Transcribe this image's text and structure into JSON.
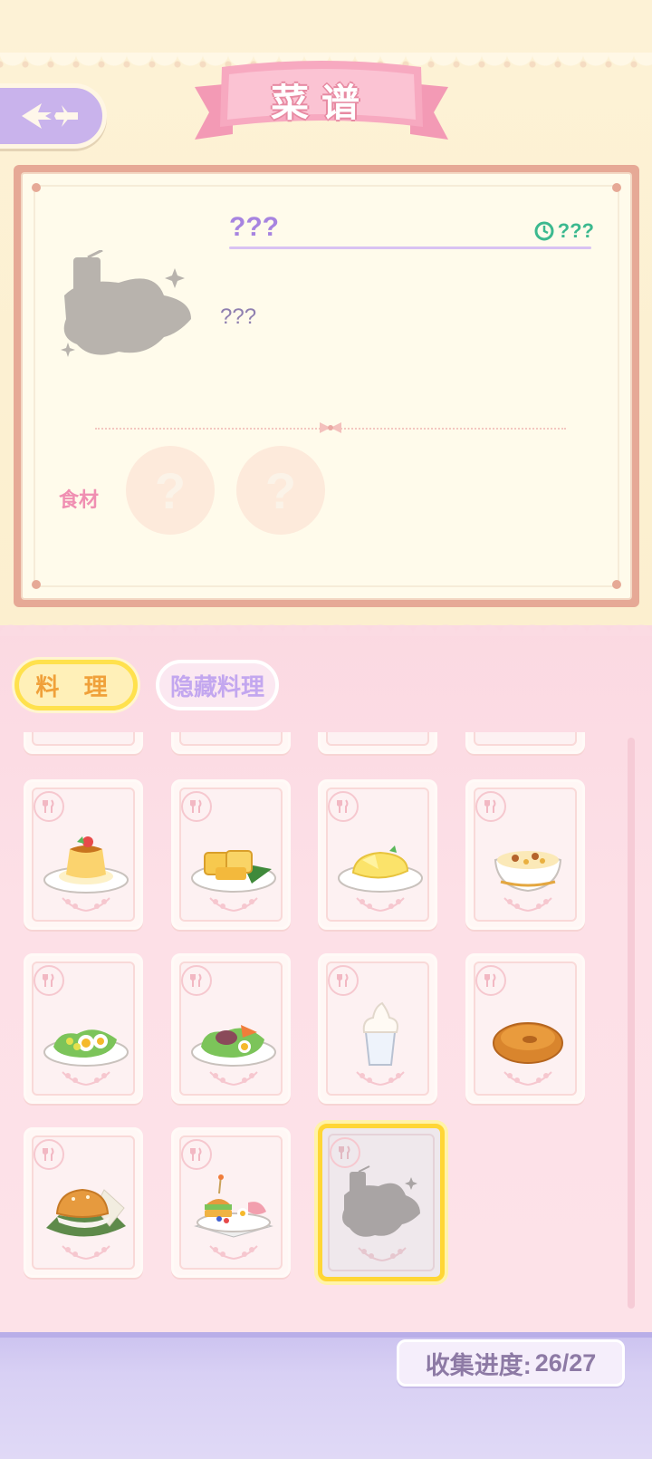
{
  "header": {
    "title": "菜谱",
    "back_icon": "back-arrow-icon"
  },
  "detail": {
    "dish_name": "???",
    "cook_time": "???",
    "description": "???",
    "ingredients_label": "食材",
    "ingredient_slots": [
      "?",
      "?"
    ]
  },
  "tabs": [
    {
      "label": "料 理",
      "active": true
    },
    {
      "label": "隐藏料理",
      "active": false
    }
  ],
  "recipes": [
    {
      "name": "strawberry-pudding",
      "locked": false
    },
    {
      "name": "tamagoyaki",
      "locked": false
    },
    {
      "name": "cheese-omelette",
      "locked": false
    },
    {
      "name": "soup-bowl",
      "locked": false
    },
    {
      "name": "egg-salad",
      "locked": false
    },
    {
      "name": "meat-salad",
      "locked": false
    },
    {
      "name": "ice-cream-drink",
      "locked": false
    },
    {
      "name": "bagel",
      "locked": false
    },
    {
      "name": "burger",
      "locked": false
    },
    {
      "name": "burger-set",
      "locked": false
    },
    {
      "name": "mystery-dish",
      "locked": true,
      "selected": true
    }
  ],
  "footer": {
    "progress_label": "收集进度:",
    "progress_value": "26/27"
  },
  "colors": {
    "accent_purple": "#a784e0",
    "accent_pink": "#f08fb2",
    "tab_active_border": "#ffe14d",
    "time_green": "#3cb98f"
  }
}
